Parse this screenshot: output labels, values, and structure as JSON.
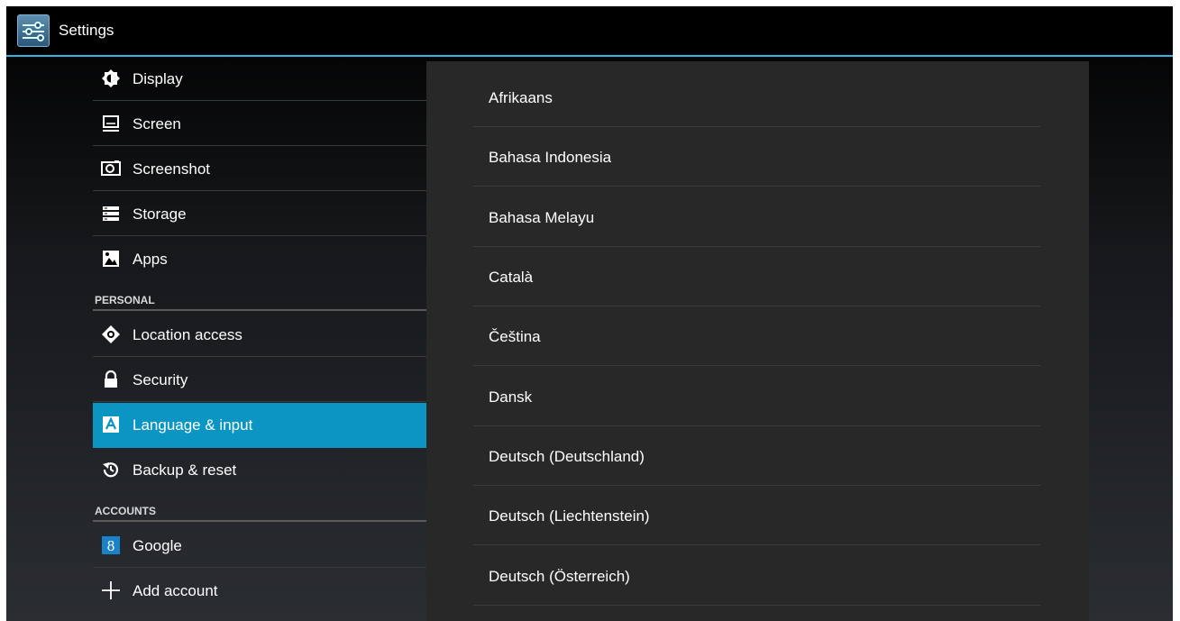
{
  "app": {
    "title": "Settings"
  },
  "device_items": [
    {
      "label": "Display",
      "icon": "brightness-icon"
    },
    {
      "label": "Screen",
      "icon": "monitor-icon"
    },
    {
      "label": "Screenshot",
      "icon": "camera-icon"
    },
    {
      "label": "Storage",
      "icon": "storage-icon"
    },
    {
      "label": "Apps",
      "icon": "apps-icon"
    }
  ],
  "sections": {
    "personal": "PERSONAL",
    "accounts": "ACCOUNTS"
  },
  "personal_items": [
    {
      "label": "Location access",
      "icon": "location-icon"
    },
    {
      "label": "Security",
      "icon": "lock-icon"
    },
    {
      "label": "Language & input",
      "icon": "language-icon",
      "selected": true
    },
    {
      "label": "Backup & reset",
      "icon": "backup-icon"
    }
  ],
  "account_items": [
    {
      "label": "Google",
      "icon": "google-icon"
    },
    {
      "label": "Add account",
      "icon": "plus-icon"
    }
  ],
  "languages": [
    "Afrikaans",
    "Bahasa Indonesia",
    "Bahasa Melayu",
    "Català",
    "Čeština",
    "Dansk",
    "Deutsch (Deutschland)",
    "Deutsch (Liechtenstein)",
    "Deutsch (Österreich)"
  ],
  "colors": {
    "accent": "#33b5e5",
    "selected": "#0a95c3",
    "panel": "#282828"
  }
}
